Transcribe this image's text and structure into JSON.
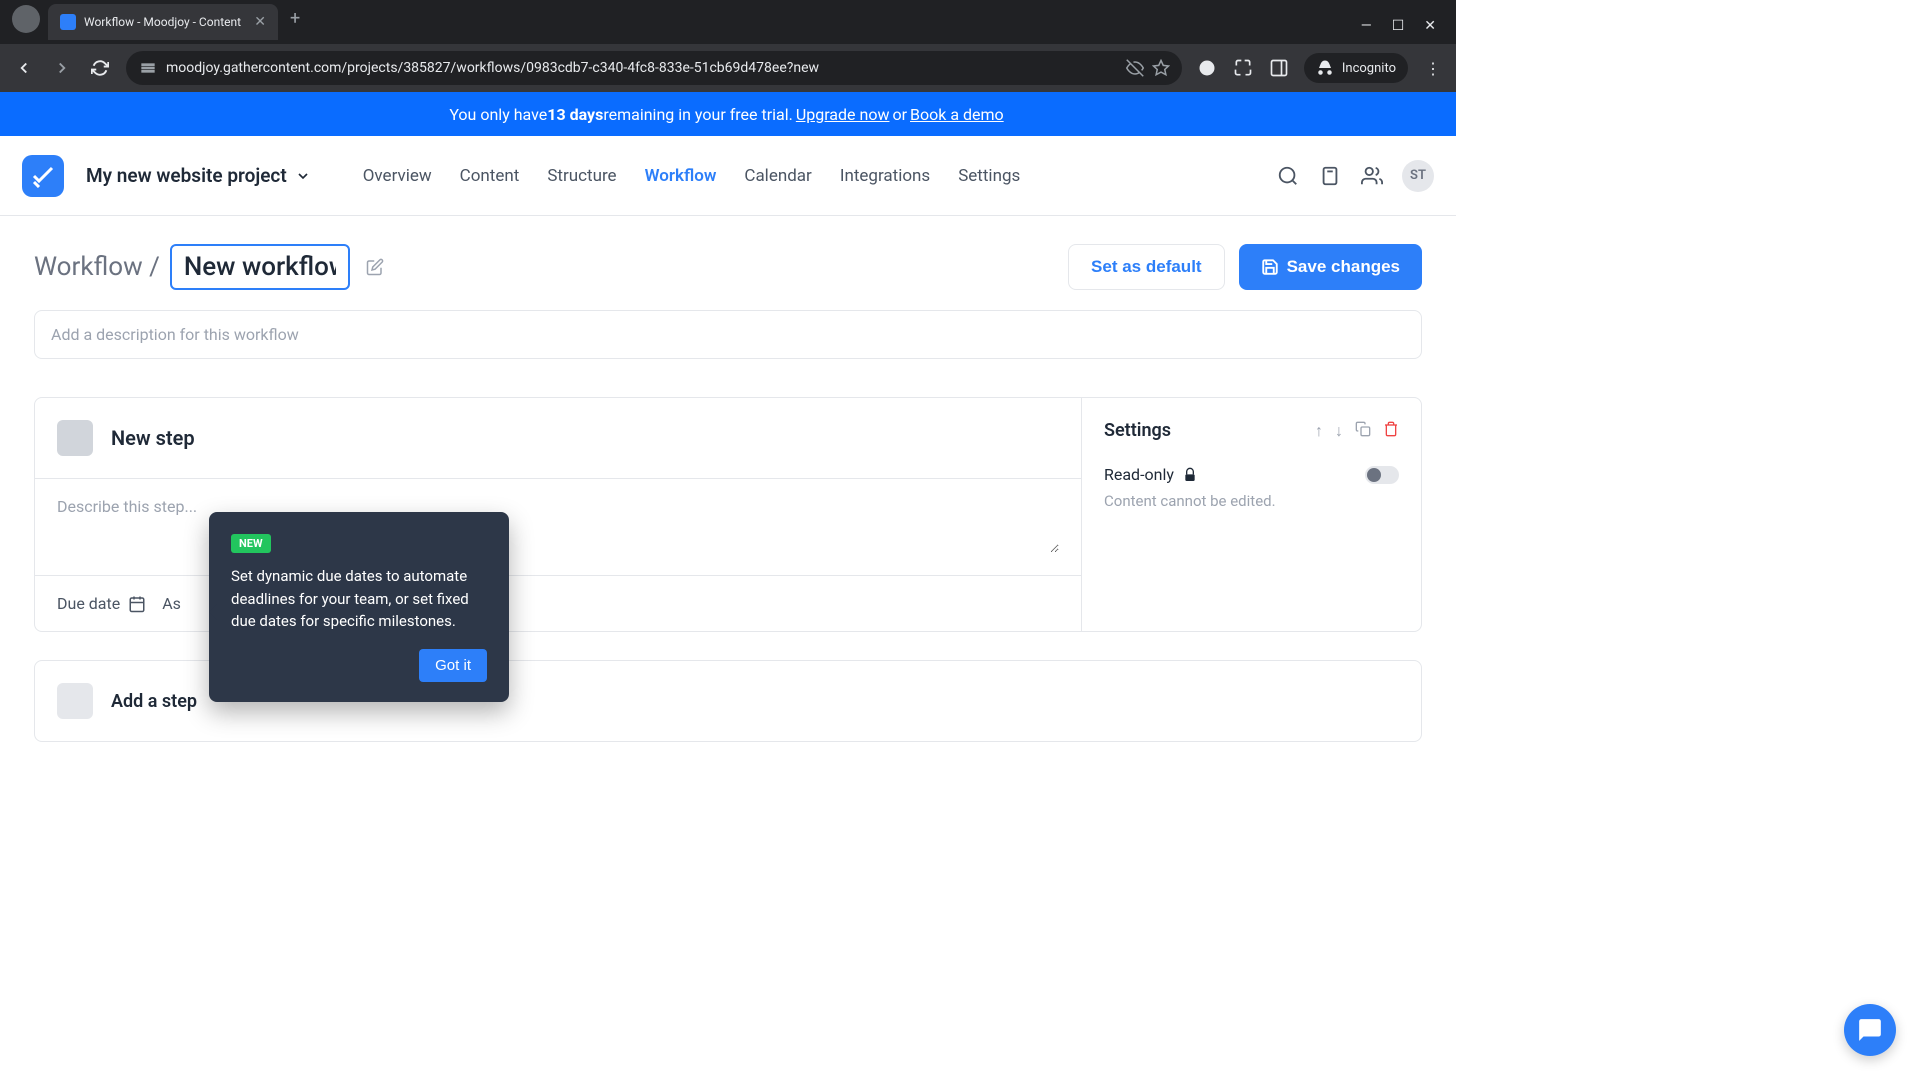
{
  "browser": {
    "tab_title": "Workflow - Moodjoy - Content",
    "url": "moodjoy.gathercontent.com/projects/385827/workflows/0983cdb7-c340-4fc8-833e-51cb69d478ee?new",
    "incognito_label": "Incognito"
  },
  "trial": {
    "prefix": "You only have ",
    "days": "13 days",
    "middle": " remaining in your free trial. ",
    "upgrade": "Upgrade now",
    "or": " or ",
    "book": "Book a demo"
  },
  "header": {
    "project_name": "My new website project",
    "nav": {
      "overview": "Overview",
      "content": "Content",
      "structure": "Structure",
      "workflow": "Workflow",
      "calendar": "Calendar",
      "integrations": "Integrations",
      "settings": "Settings"
    },
    "avatar": "ST"
  },
  "page": {
    "breadcrumb": "Workflow /",
    "title": "New workflow",
    "desc_placeholder": "Add a description for this workflow",
    "set_default": "Set as default",
    "save": "Save changes"
  },
  "step": {
    "name": "New step",
    "desc_placeholder": "Describe this step...",
    "due_date": "Due date",
    "assignees": "As",
    "settings_title": "Settings",
    "readonly": "Read-only",
    "readonly_hint": "Content cannot be edited."
  },
  "add_step": "Add a step",
  "tooltip": {
    "badge": "NEW",
    "text": "Set dynamic due dates to automate deadlines for your team, or set fixed due dates for specific milestones.",
    "button": "Got it"
  }
}
